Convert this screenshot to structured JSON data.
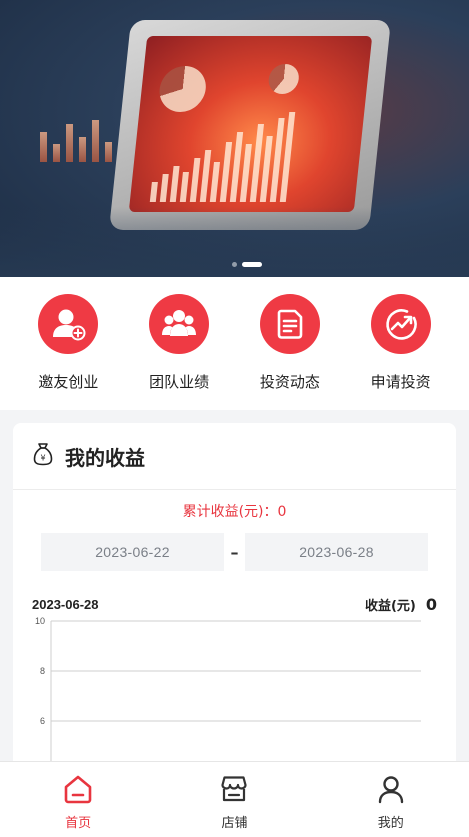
{
  "nav": [
    {
      "label": "邀友创业",
      "icon": "add-user-icon"
    },
    {
      "label": "团队业绩",
      "icon": "team-icon"
    },
    {
      "label": "投资动态",
      "icon": "document-icon"
    },
    {
      "label": "申请投资",
      "icon": "trend-up-icon"
    }
  ],
  "earnings": {
    "title": "我的收益",
    "total": "累计收益(元)：0",
    "date_start": "2023-06-22",
    "date_separator": "–",
    "date_end": "2023-06-28",
    "current_date": "2023-06-28",
    "income_label": "收益(元)",
    "income_value": "0"
  },
  "chart_data": {
    "type": "line",
    "x": [],
    "series": [],
    "yticks": [
      10,
      8,
      6
    ],
    "tick_labels": [
      "10",
      "8",
      "6"
    ],
    "grid": true
  },
  "tabs": [
    {
      "label": "首页",
      "icon": "home-icon",
      "active": true
    },
    {
      "label": "店铺",
      "icon": "store-icon",
      "active": false
    },
    {
      "label": "我的",
      "icon": "profile-icon",
      "active": false
    }
  ],
  "colors": {
    "accent": "#ef3a44",
    "active_tab": "#e8353f"
  }
}
